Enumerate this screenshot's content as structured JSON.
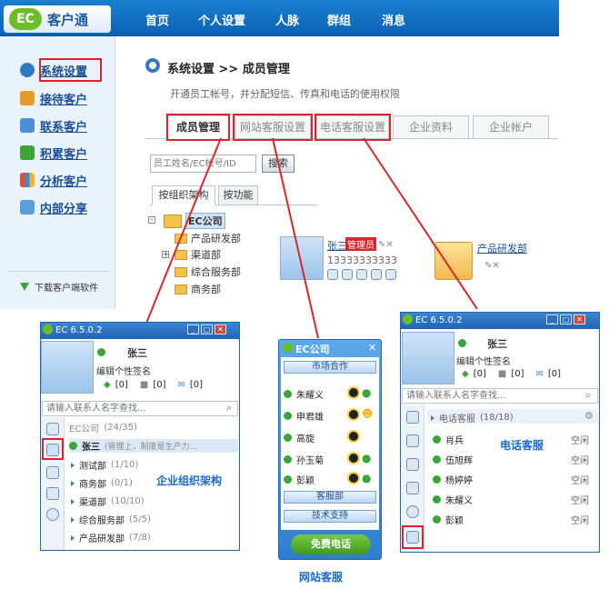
{
  "app": {
    "logo_badge": "EC",
    "name": "客户通"
  },
  "nav": [
    "首页",
    "个人设置",
    "人脉",
    "群组",
    "消息"
  ],
  "sidebar": {
    "items": [
      {
        "label": "系统设置",
        "icon": "gear-icon"
      },
      {
        "label": "接待客户",
        "icon": "user-reception-icon"
      },
      {
        "label": "联系客户",
        "icon": "contact-icon"
      },
      {
        "label": "积累客户",
        "icon": "accumulate-icon"
      },
      {
        "label": "分析客户",
        "icon": "chart-icon"
      },
      {
        "label": "内部分享",
        "icon": "share-folder-icon"
      }
    ],
    "download": "下载客户端软件"
  },
  "main": {
    "breadcrumb": "系统设置 >> 成员管理",
    "subtitle": "开通员工帐号，并分配短信、传真和电话的使用权限",
    "tabs": [
      "成员管理",
      "网站客服设置",
      "电话客服设置",
      "企业资料",
      "企业帐户"
    ],
    "search_placeholder": "员工姓名/EC帐号/ID",
    "search_button": "搜索",
    "subtabs": [
      "按组织架构",
      "按功能"
    ],
    "tree": {
      "root": "EC公司",
      "children": [
        "产品研发部",
        "渠道部",
        "综合服务部",
        "商务部"
      ]
    },
    "card": {
      "name": "张三",
      "badge": "管理员",
      "phone": "13333333333"
    },
    "dept_card": {
      "name": "产品研发部"
    }
  },
  "win1": {
    "title": "EC 6.5.0.2",
    "user": "张三",
    "signature": "编辑个性签名",
    "counts": [
      "[0]",
      "[0]",
      "[0]"
    ],
    "search_placeholder": "请输入联系人名字查找...",
    "group": "EC公司",
    "group_count": "(24/35)",
    "member": "张三",
    "member_status": "(管理上，制度是生产力...",
    "depts": [
      {
        "name": "测试部",
        "count": "(1/10)"
      },
      {
        "name": "商务部",
        "count": "(0/1)"
      },
      {
        "name": "渠道部",
        "count": "(10/10)"
      },
      {
        "name": "综合服务部",
        "count": "(5/5)"
      },
      {
        "name": "产品研发部",
        "count": "(7/8)"
      }
    ],
    "caption": "企业组织架构"
  },
  "win2": {
    "title": "EC公司",
    "groups": [
      "市场合作",
      "客服部",
      "技术支持"
    ],
    "members": [
      "朱耀义",
      "申君雄",
      "高旋",
      "孙玉菊",
      "彭颖"
    ],
    "call_button": "免费电话",
    "caption": "网站客服"
  },
  "win3": {
    "title": "EC 6.5.0.2",
    "user": "张三",
    "signature": "编辑个性签名",
    "counts": [
      "[0]",
      "[0]",
      "[0]"
    ],
    "search_placeholder": "请输入联系人名字查找...",
    "group": "电话客服",
    "group_count": "(18/18)",
    "members": [
      "肖兵",
      "伍旭辉",
      "杨婷婷",
      "朱耀义",
      "彭颖"
    ],
    "status": "空闲",
    "caption": "电话客服"
  },
  "colors": {
    "accent": "#1b6ac9",
    "highlight": "#d9262c"
  }
}
